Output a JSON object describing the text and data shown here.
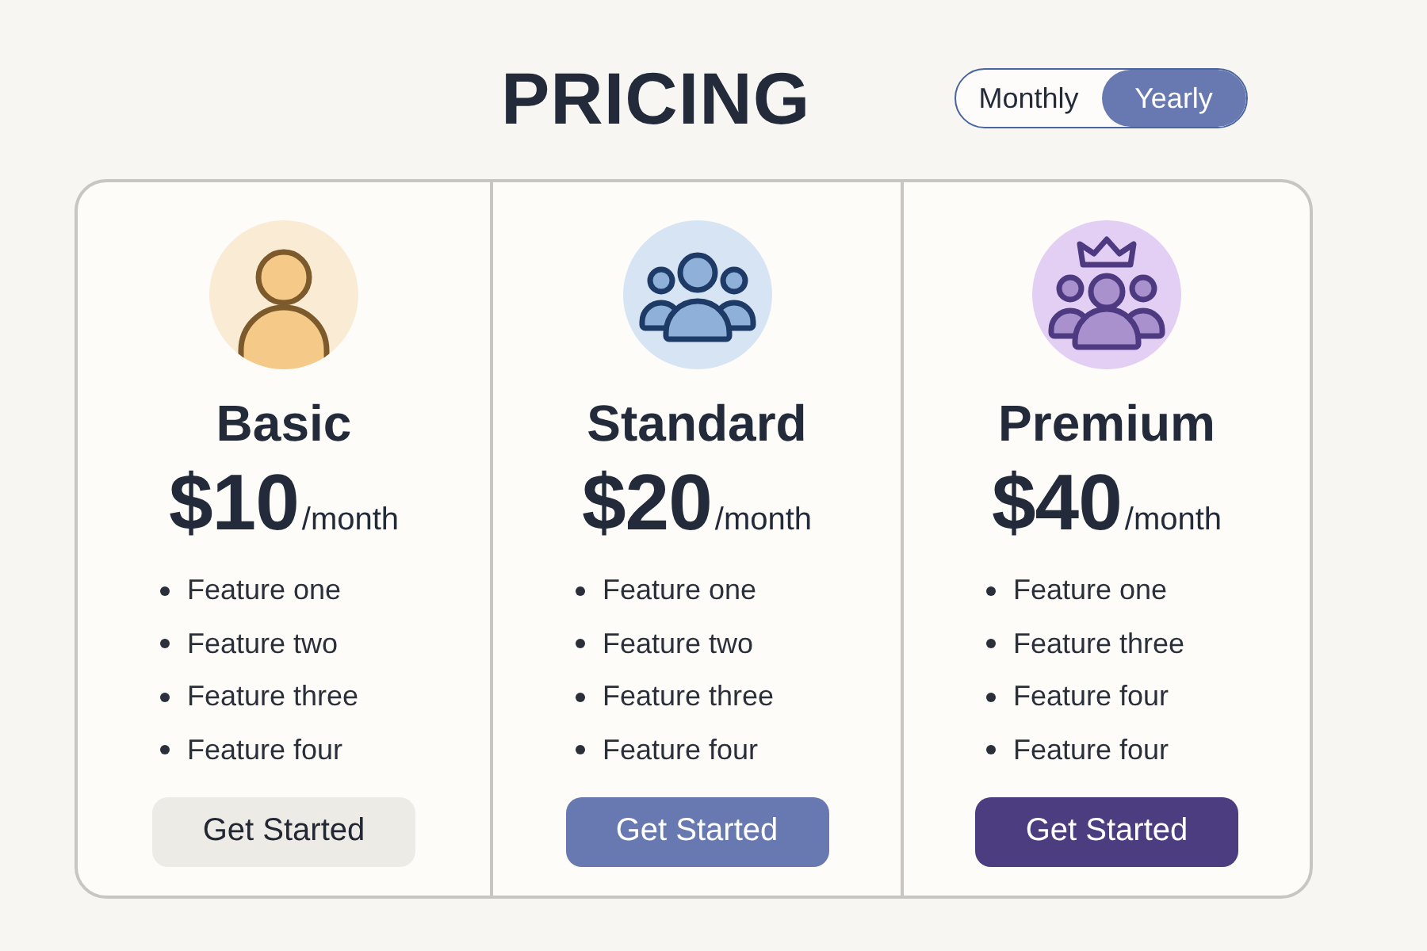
{
  "title": "PRICING",
  "billing_toggle": {
    "options": [
      {
        "label": "Monthly",
        "selected": false
      },
      {
        "label": "Yearly",
        "selected": true
      }
    ]
  },
  "plans": [
    {
      "kind": "basic",
      "name": "Basic",
      "price": "$10",
      "period": "/month",
      "features": [
        "Feature one",
        "Feature two",
        "Feature three",
        "Feature four"
      ],
      "button": "Get Started"
    },
    {
      "kind": "standard",
      "name": "Standard",
      "price": "$20",
      "period": "/month",
      "features": [
        "Feature one",
        "Feature two",
        "Feature three",
        "Feature four"
      ],
      "button": "Get Started"
    },
    {
      "kind": "premium",
      "name": "Premium",
      "price": "$40",
      "period": "/month",
      "features": [
        "Feature one",
        "Feature three",
        "Feature four",
        "Feature four"
      ],
      "button": "Get Started"
    }
  ]
}
